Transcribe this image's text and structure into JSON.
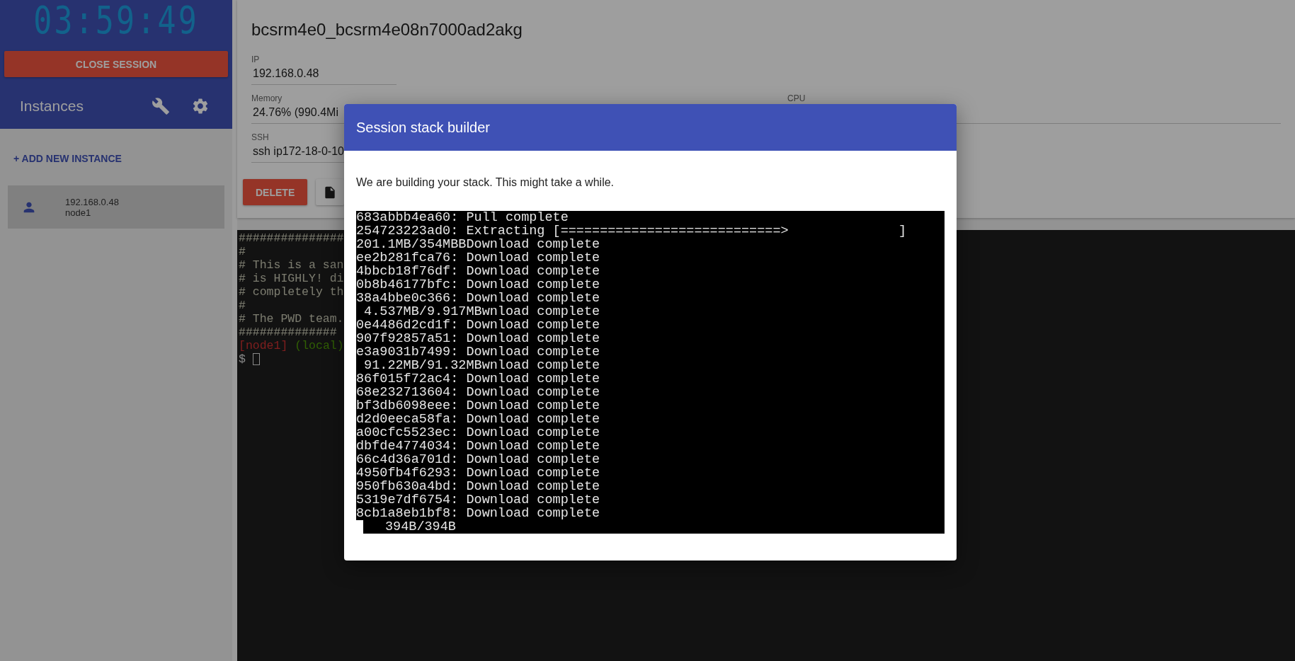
{
  "sidebar": {
    "timer": "03:59:49",
    "close_button": "CLOSE SESSION",
    "heading": "Instances",
    "add_link": "+ ADD NEW INSTANCE",
    "instances": [
      {
        "ip": "192.168.0.48",
        "name": "node1",
        "selected": true
      }
    ]
  },
  "instance": {
    "title": "bcsrm4e0_bcsrm4e08n7000ad2akg",
    "rows": [
      [
        {
          "label": "IP",
          "value": "192.168.0.48"
        }
      ],
      [
        {
          "label": "Memory",
          "value": "24.76% (990.4Mi"
        },
        {
          "label": "CPU"
        }
      ],
      [
        {
          "label": "SSH",
          "value": "ssh ip172-18-0-10"
        }
      ]
    ],
    "buttons": [
      {
        "label": "DELETE",
        "kind": "danger"
      },
      {
        "kind": "file"
      }
    ]
  },
  "terminal": {
    "lines": [
      "###############",
      "#",
      "# This is a san",
      "# is HIGHLY! di",
      "# completely th",
      "#",
      "# The PWD team.",
      "##############"
    ],
    "prompt": {
      "host": "[node1]",
      "location": "(local)",
      "symbol": "$"
    }
  },
  "modal": {
    "title": "Session stack builder",
    "message": "We are building your stack. This might take a while.",
    "log": [
      "683abbb4ea60: Pull complete",
      "254723223ad0: Extracting [============================>              ]",
      "201.1MB/354MBBDownload complete",
      "ee2b281fca76: Download complete",
      "4bbcb18f76df: Download complete",
      "0b8b46177bfc: Download complete",
      "38a4bbe0c366: Download complete",
      " 4.537MB/9.917MBwnload complete",
      "0e4486d2cd1f: Download complete",
      "907f92857a51: Download complete",
      "e3a9031b7499: Download complete",
      " 91.22MB/91.32MBwnload complete",
      "86f015f72ac4: Download complete",
      "68e232713604: Download complete",
      "bf3db6098eee: Download complete",
      "d2d0eeca58fa: Download complete",
      "a00cfc5523ec: Download complete",
      "dbfde4774034: Download complete",
      "66c4d36a701d: Download complete",
      "4950fb4f6293: Download complete",
      "950fb630a4bd: Download complete",
      "5319e7df6754: Download complete",
      "8cb1a8eb1bf8: Download complete"
    ],
    "progress_line": "394B/394B"
  }
}
